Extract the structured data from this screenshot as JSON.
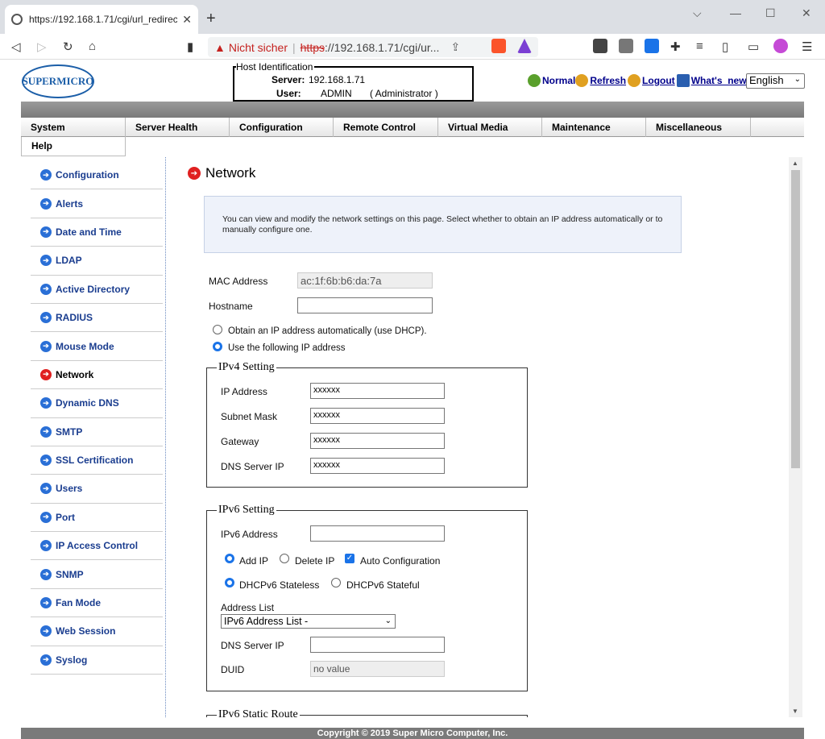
{
  "browser": {
    "tab_title": "https://192.168.1.71/cgi/url_redirect.c",
    "not_secure": "Nicht sicher",
    "url_scheme": "https",
    "url_rest": "://192.168.1.71/cgi/ur...",
    "new_tab": "+",
    "tab_close": "✕"
  },
  "header": {
    "logo_text": "SUPERMICRO",
    "host_legend": "Host Identification",
    "server_label": "Server:",
    "server_value": "192.168.1.71",
    "user_label": "User:",
    "user_value": "ADMIN",
    "user_role": "( Administrator )",
    "links": {
      "normal": "Normal",
      "refresh": "Refresh",
      "logout": "Logout",
      "whats_new": "What's_new"
    },
    "language": "English"
  },
  "menu": [
    "System",
    "Server Health",
    "Configuration",
    "Remote Control",
    "Virtual Media",
    "Maintenance",
    "Miscellaneous"
  ],
  "help_tab": "Help",
  "sidebar": [
    "Configuration",
    "Alerts",
    "Date and Time",
    "LDAP",
    "Active Directory",
    "RADIUS",
    "Mouse Mode",
    "Network",
    "Dynamic DNS",
    "SMTP",
    "SSL Certification",
    "Users",
    "Port",
    "IP Access Control",
    "SNMP",
    "Fan Mode",
    "Web Session",
    "Syslog"
  ],
  "page": {
    "title": "Network",
    "info": "You can view and modify the network settings on this page. Select whether to obtain an IP address automatically or to manually configure one.",
    "mac_label": "MAC Address",
    "mac_value": "ac:1f:6b:b6:da:7a",
    "hostname_label": "Hostname",
    "hostname_value": "",
    "dhcp_label": "Obtain an IP address automatically (use DHCP).",
    "static_label": "Use the following IP address",
    "ipv4": {
      "legend": "IPv4 Setting",
      "ip_label": "IP Address",
      "ip_value": "xxxxxx",
      "subnet_label": "Subnet Mask",
      "subnet_value": "xxxxxx",
      "gateway_label": "Gateway",
      "gateway_value": "xxxxxx",
      "dns_label": "DNS Server IP",
      "dns_value": "xxxxxx"
    },
    "ipv6": {
      "legend": "IPv6 Setting",
      "addr_label": "IPv6 Address",
      "add_ip": "Add IP",
      "delete_ip": "Delete IP",
      "auto_config": "Auto Configuration",
      "stateless": "DHCPv6 Stateless",
      "stateful": "DHCPv6 Stateful",
      "list_label": "Address List",
      "list_value": "IPv6 Address List -",
      "dns_label": "DNS Server IP",
      "duid_label": "DUID",
      "duid_value": "no value"
    },
    "static_route_legend": "IPv6 Static Route"
  },
  "footer": "Copyright © 2019 Super Micro Computer, Inc."
}
